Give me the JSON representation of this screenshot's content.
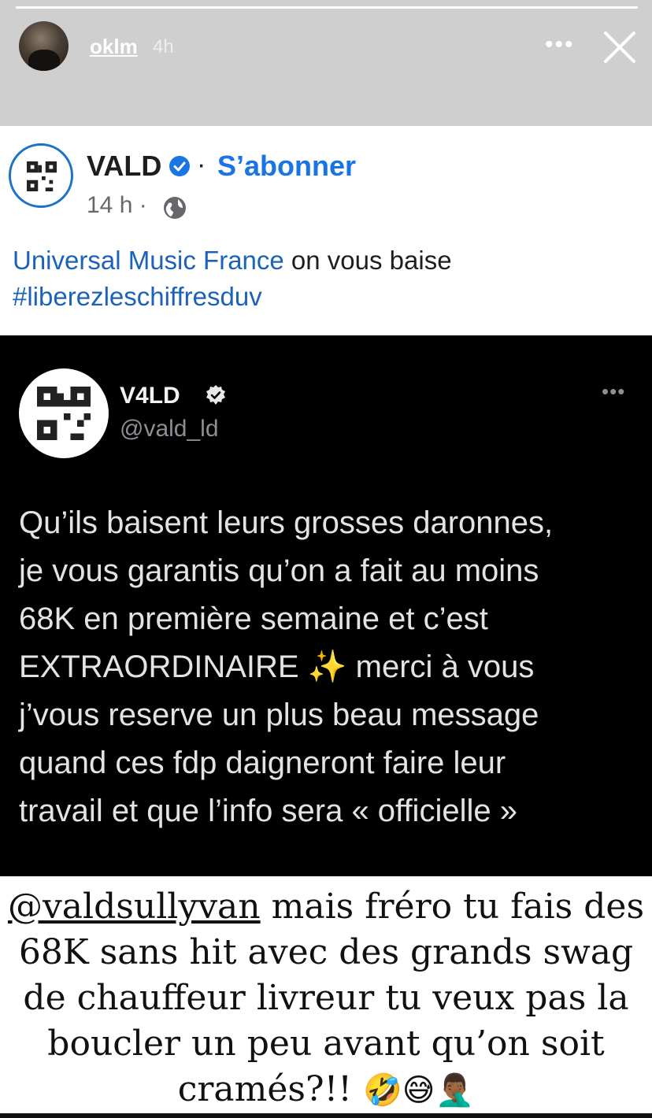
{
  "story": {
    "username": "oklm",
    "time": "4h",
    "more_icon": "more-horizontal-icon",
    "close_icon": "close-icon",
    "progress": 1.0
  },
  "facebook_post": {
    "page_name": "VALD",
    "separator": "·",
    "follow_label": "S’abonner",
    "meta": "14 h ·",
    "text_link": "Universal Music France",
    "text_rest": " on vous baise",
    "hashtag": "#liberezleschiffresduv",
    "accent_color": "#1b74e4"
  },
  "tweet": {
    "display_name": "V4LD",
    "handle": "@vald_ld",
    "body_lines": [
      "Qu’ils baisent leurs grosses daronnes,",
      "je vous garantis qu’on a fait au moins",
      "68K en première semaine et c’est",
      "EXTRAORDINAIRE",
      " merci à vous",
      "j’vous reserve un plus beau message",
      "quand ces fdp daigneront faire leur",
      "travail et que l’info sera « officielle »"
    ],
    "sparkles": "✨"
  },
  "caption": {
    "mention": "@valdsullyvan",
    "text": " mais fréro tu fais des 68K sans hit avec des grands swag de chauffeur livreur tu veux pas la boucler un peu avant qu’on soit cramés?!! ",
    "emojis": "🤣😅🤦🏾‍♂️"
  }
}
